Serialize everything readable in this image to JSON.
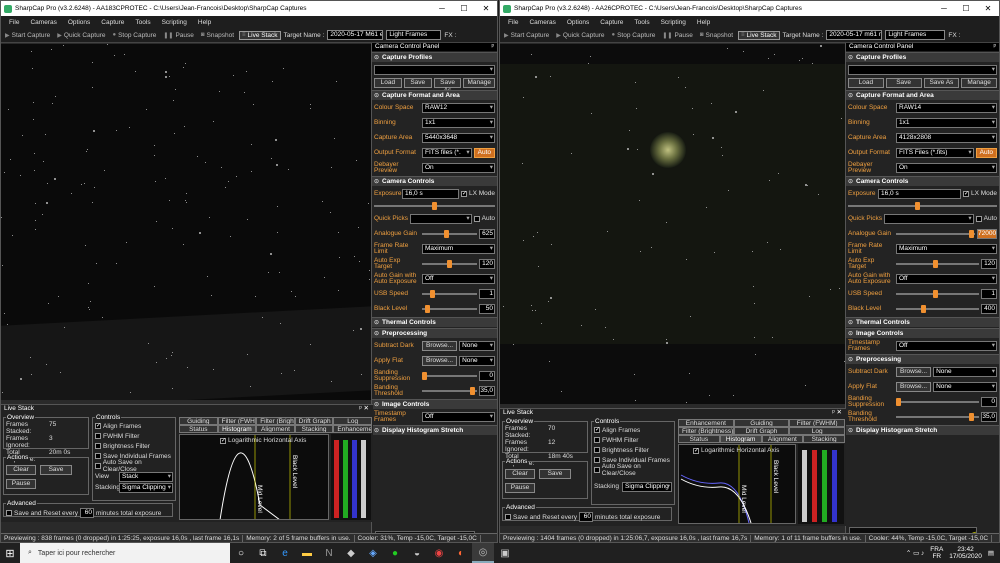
{
  "windows": [
    {
      "title": "SharpCap Pro (v3.2.6248) - AA183CPROTEC - C:\\Users\\Jean-Francois\\Desktop\\SharpCap Captures",
      "target": "2020-05-17 M61 ec",
      "frame_type": "Light Frames",
      "controls": {
        "colour_space": "RAW12",
        "binning": "1x1",
        "capture_area": "5440x3648",
        "output_format": "FITS files (*.",
        "debayer": "On",
        "exposure": "16,0 s",
        "analogue_gain": "625",
        "frame_rate": "Maximum",
        "auto_exp_target": "120",
        "auto_gain": "Off",
        "usb_speed": "1",
        "black_level": "50",
        "preprocessing": {
          "subtract_dark": "None",
          "apply_flat": "None",
          "banding": "0",
          "banding_threshold": "35,0"
        },
        "timestamp": "Off"
      },
      "live": {
        "stacked": "75",
        "ignored": "3",
        "total": "20m 0s",
        "view": "Stack",
        "stacking": "Sigma Clipping",
        "minutes": "60",
        "tabs1": [
          "Guiding",
          "Filter (FWHM)",
          "Filter (Brightness)",
          "Drift Graph",
          "Log"
        ],
        "tabs2": [
          "Status",
          "Histogram",
          "Alignment",
          "Stacking",
          "Enhancement"
        ],
        "checks": [
          "Align Frames",
          "FWHM Filter",
          "Brightness Filter",
          "Save Individual Frames",
          "Auto Save on Clear/Close"
        ]
      },
      "status": [
        "Previewing : 838 frames (0 dropped) in 1:25:25, exposure 16,0s , last frame 16,1s",
        "Memory: 2 of 5 frame buffers in use."
      ]
    },
    {
      "title": "SharpCap Pro (v3.2.6248) - AA26CPROTEC - C:\\Users\\Jean-Francois\\Desktop\\SharpCap Captures",
      "target": "2020-05-17 m61 m",
      "frame_type": "Light Frames",
      "controls": {
        "colour_space": "RAW14",
        "binning": "1x1",
        "capture_area": "4128x2808",
        "output_format": "FITS Files (*.fits)",
        "debayer": "On",
        "exposure": "16,0 s",
        "analogue_gain": "72000",
        "frame_rate": "Maximum",
        "auto_exp_target": "120",
        "auto_gain": "Off",
        "usb_speed": "1",
        "black_level": "400",
        "timestamp": "Off",
        "preprocessing": {
          "subtract_dark": "None",
          "apply_flat": "None",
          "banding": "0",
          "banding_threshold": "35,0"
        }
      },
      "live": {
        "stacked": "70",
        "ignored": "12",
        "total": "18m 40s",
        "view": "",
        "stacking": "Sigma Clipping",
        "minutes": "60",
        "tabs1": [
          "Enhancement",
          "Guiding",
          "Filter (FWHM)",
          "Filter (Brightness)",
          "Drift Graph",
          "Log"
        ],
        "tabs2": [
          "Status",
          "Histogram",
          "Alignment",
          "Stacking"
        ],
        "checks": [
          "Align Frames",
          "FWHM Filter",
          "Brightness Filter",
          "Save Individual Frames",
          "Auto Save on Clear/Close"
        ]
      },
      "status": [
        "Previewing : 1404 frames (0 dropped) in 1:25:06,7, exposure 16,0s , last frame 16,7s",
        "Memory: 1 of 11 frame buffers in use.",
        "Cooler: 44%, Temp -15,0C, Target -15,0C"
      ]
    }
  ],
  "common": {
    "menu": [
      "File",
      "Cameras",
      "Options",
      "Capture",
      "Tools",
      "Scripting",
      "Help"
    ],
    "toolbar": [
      "Start Capture",
      "Quick Capture",
      "Stop Capture",
      "Pause",
      "Snapshot",
      "Live Stack"
    ],
    "target_label": "Target Name :",
    "fx": "FX :",
    "panel_title": "Camera Control Panel",
    "sections": {
      "profiles": "Capture Profiles",
      "format": "Capture Format and Area",
      "camera": "Camera Controls",
      "thermal": "Thermal Controls",
      "image": "Image Controls",
      "pre": "Preprocessing",
      "histo": "Display Histogram Stretch"
    },
    "labels": {
      "colour_space": "Colour Space",
      "binning": "Binning",
      "capture_area": "Capture Area",
      "output_format": "Output Format",
      "debayer": "Debayer Preview",
      "exposure": "Exposure",
      "lx": "LX Mode",
      "quick": "Quick Picks",
      "auto": "Auto",
      "gain": "Analogue Gain",
      "frame_rate": "Frame Rate Limit",
      "auto_exp": "Auto Exp Target",
      "auto_gain": "Auto Gain with Auto Exposure",
      "usb": "USB Speed",
      "black": "Black Level",
      "subtract": "Subtract Dark",
      "flat": "Apply Flat",
      "banding": "Banding Suppression",
      "bthresh": "Banding Threshold",
      "timestamp": "Timestamp Frames",
      "browse": "Browse..."
    },
    "profile_buttons": [
      "Load",
      "Save",
      "Save As",
      "Manage"
    ],
    "live": {
      "title": "Live Stack",
      "overview": "Overview",
      "controls": "Controls",
      "actions": "Actions",
      "advanced": "Advanced",
      "stacked": "Frames Stacked:",
      "ignored": "Frames Ignored:",
      "total": "Total Exposure:",
      "clear": "Clear",
      "save": "Save",
      "pause": "Pause",
      "view": "View",
      "stacking": "Stacking",
      "save_reset": "Save and Reset every",
      "minutes_total": "minutes total exposure",
      "log_hist": "Logarithmic Horizontal Axis",
      "mid": "Mid Level",
      "black": "Black Level"
    },
    "cooler_left": "Cooler: 31%, Temp -15,0C, Target -15,0C"
  },
  "taskbar": {
    "search": "Taper ici pour rechercher",
    "lang1": "FRA",
    "lang2": "FR",
    "time": "23:42",
    "date": "17/05/2020"
  }
}
